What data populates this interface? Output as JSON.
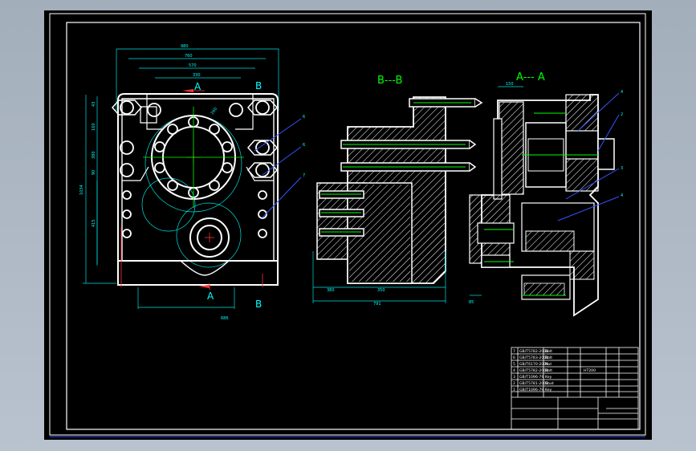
{
  "drawing": {
    "section_labels": {
      "a_top": "A",
      "b_top": "B",
      "a_bottom": "A",
      "b_bottom": "B",
      "section_bb": "B---B",
      "section_aa": "A--- A"
    },
    "dimensions": {
      "front_width_overall": "980",
      "front_width_2": "760",
      "front_width_3": "570",
      "front_width_4": "330",
      "front_height_overall": "1034",
      "front_height_lower": "415",
      "front_height_a": "43",
      "front_height_b": "160",
      "front_height_c": "380",
      "front_height_d": "90",
      "front_bottom_width": "686",
      "front_circle_dia": "260",
      "side_bottom_1": "380",
      "side_bottom_2": "350",
      "side_bottom_3": "791",
      "right_top_dim": "150",
      "right_bottom_dim": "85"
    },
    "leaders": {
      "front_1": "6",
      "front_2": "6",
      "front_3": "7",
      "right_1": "4",
      "right_2": "2",
      "right_3": "3",
      "right_4": "4"
    }
  },
  "title_block": {
    "parts_list": [
      {
        "no": "7",
        "code": "GB/T5782-2000",
        "name": "Bolt"
      },
      {
        "no": "6",
        "code": "GB/T5783-2000",
        "name": "Bolt"
      },
      {
        "no": "5",
        "code": "GB/T6170-2000",
        "name": "Nut"
      },
      {
        "no": "4",
        "code": "GB/T5782-2000",
        "name": "Bolt"
      },
      {
        "no": "3",
        "code": "GB/T1096-79",
        "name": "Key"
      },
      {
        "no": "2",
        "code": "GB/T5781-2000",
        "name": "Stud"
      },
      {
        "no": "1",
        "code": "GB/T1096-79",
        "name": "Key"
      }
    ],
    "material_note": "HT200"
  }
}
